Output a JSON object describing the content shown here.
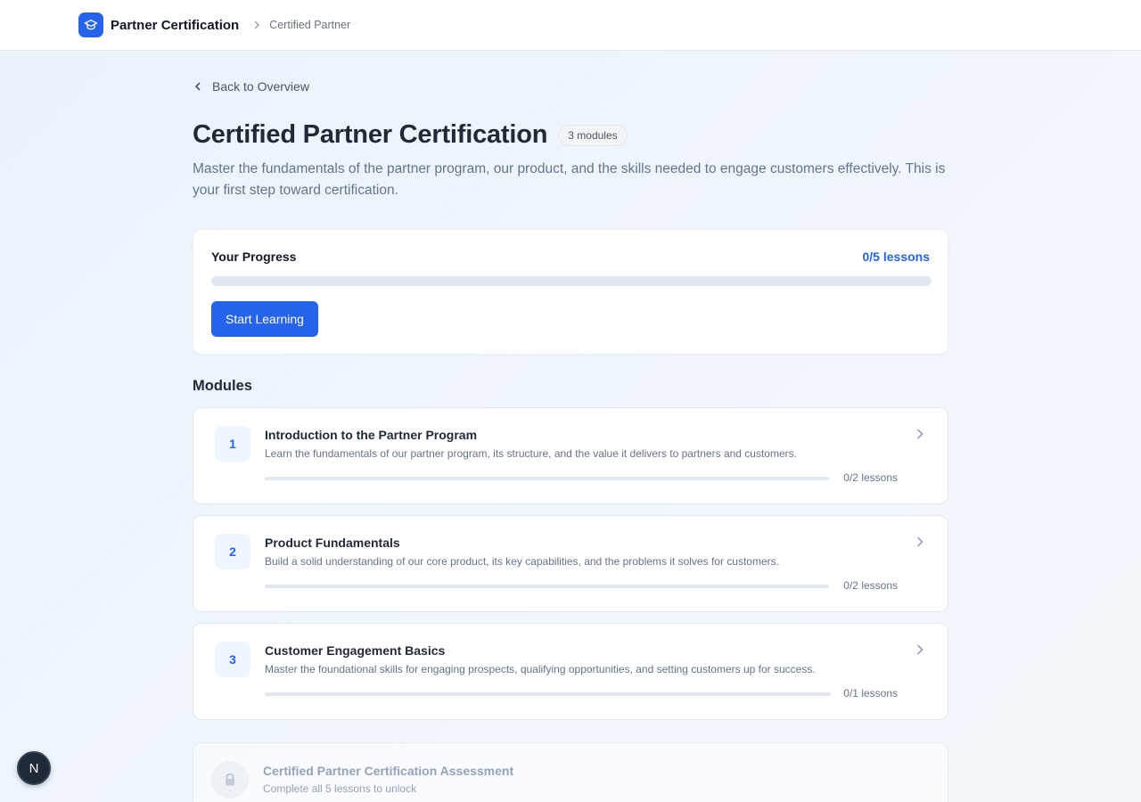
{
  "header": {
    "brand": "Partner Certification",
    "breadcrumb": "Certified Partner",
    "logo_icon": "graduation-cap-icon"
  },
  "back_link": "Back to Overview",
  "page": {
    "title": "Certified Partner Certification",
    "badge": "3 modules",
    "description": "Master the fundamentals of the partner program, our product, and the skills needed to engage customers effectively. This is your first step toward certification."
  },
  "progress": {
    "label": "Your Progress",
    "count": "0/5 lessons",
    "fraction": 0,
    "button_label": "Start Learning"
  },
  "modules_heading": "Modules",
  "modules": [
    {
      "number": "1",
      "title": "Introduction to the Partner Program",
      "description": "Learn the fundamentals of our partner program, its structure, and the value it delivers to partners and customers.",
      "count": "0/2 lessons",
      "fraction": 0
    },
    {
      "number": "2",
      "title": "Product Fundamentals",
      "description": "Build a solid understanding of our core product, its key capabilities, and the problems it solves for customers.",
      "count": "0/2 lessons",
      "fraction": 0
    },
    {
      "number": "3",
      "title": "Customer Engagement Basics",
      "description": "Master the foundational skills for engaging prospects, qualifying opportunities, and setting customers up for success.",
      "count": "0/1 lessons",
      "fraction": 0
    }
  ],
  "assessment": {
    "title": "Certified Partner Certification Assessment",
    "subtitle": "Complete all 5 lessons to unlock",
    "icon": "lock-icon"
  },
  "dev_badge": {
    "label": "N"
  },
  "colors": {
    "accent": "#2563eb",
    "background": "#eef4fc",
    "track": "#e2e8f0"
  }
}
